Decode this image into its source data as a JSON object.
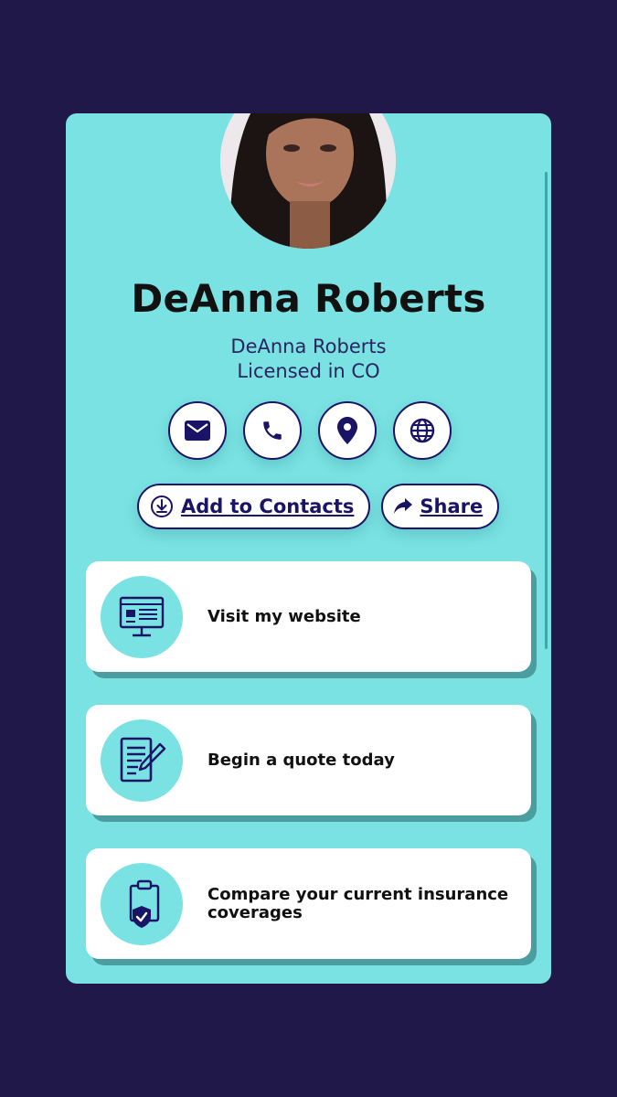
{
  "profile": {
    "name": "DeAnna Roberts",
    "subtitle_line1": "DeAnna Roberts",
    "subtitle_line2": "Licensed in CO"
  },
  "contact_icons": [
    "mail-icon",
    "phone-icon",
    "location-pin-icon",
    "globe-icon"
  ],
  "actions": {
    "add_contacts": "Add to Contacts",
    "share": "Share"
  },
  "links": [
    {
      "label": "Visit my website",
      "icon": "website-icon"
    },
    {
      "label": "Begin a quote today",
      "icon": "document-edit-icon"
    },
    {
      "label": "Compare your current insurance coverages",
      "icon": "clipboard-shield-icon"
    }
  ],
  "colors": {
    "background": "#1f1848",
    "card": "#7ae2e2",
    "accent": "#1a1466"
  }
}
